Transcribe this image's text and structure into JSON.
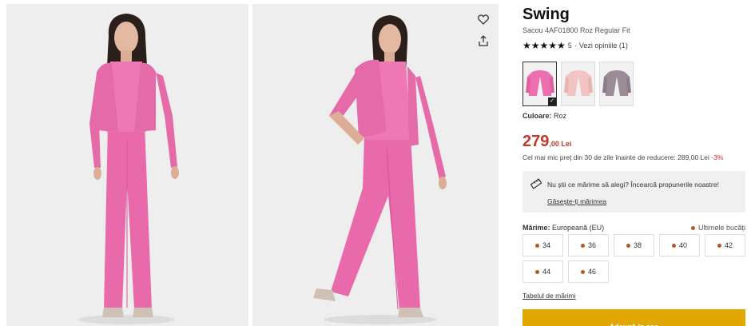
{
  "product": {
    "title": "Swing",
    "subtitle": "Sacou 4AF01800 Roz Regular Fit",
    "rating": {
      "stars": "★★★★★",
      "score": "5",
      "separator": "·",
      "reviews": "Vezi opiniile (1)"
    }
  },
  "colors": {
    "label": "Culoare:",
    "value": "Roz",
    "swatches": [
      {
        "name": "roz",
        "color": "#ec6fb0",
        "selected": true
      },
      {
        "name": "roz-pal",
        "color": "#f2c4c4",
        "selected": false
      },
      {
        "name": "gri",
        "color": "#9c8c97",
        "selected": false
      }
    ],
    "selected_mark": "✓"
  },
  "price": {
    "integer": "279",
    "decimals": ",00 Lei",
    "note": "Cel mai mic preț din 30 de zile înainte de reducere: 289,00 Lei",
    "discount": "-3%"
  },
  "advisor": {
    "question": "Nu știi ce mărime să alegi? Încearcă propunerile noastre!",
    "link": "Găsește-ți mărimea"
  },
  "size": {
    "label": "Mărime:",
    "system": "Europeană (EU)",
    "stock_note": "Ultimele bucăți",
    "options": [
      "34",
      "36",
      "38",
      "40",
      "42",
      "44",
      "46"
    ],
    "chart_link": "Tabelul de mărimi"
  },
  "cart": {
    "button": "Adaugă în coș"
  },
  "icons": {
    "wishlist": "heart-icon",
    "share": "share-icon",
    "size_advisor": "ruler-icon"
  },
  "palette": {
    "pink": "#e96aaa",
    "price": "#c0392b",
    "cta": "#e0a800",
    "stock_dot": "#b35c1e"
  }
}
